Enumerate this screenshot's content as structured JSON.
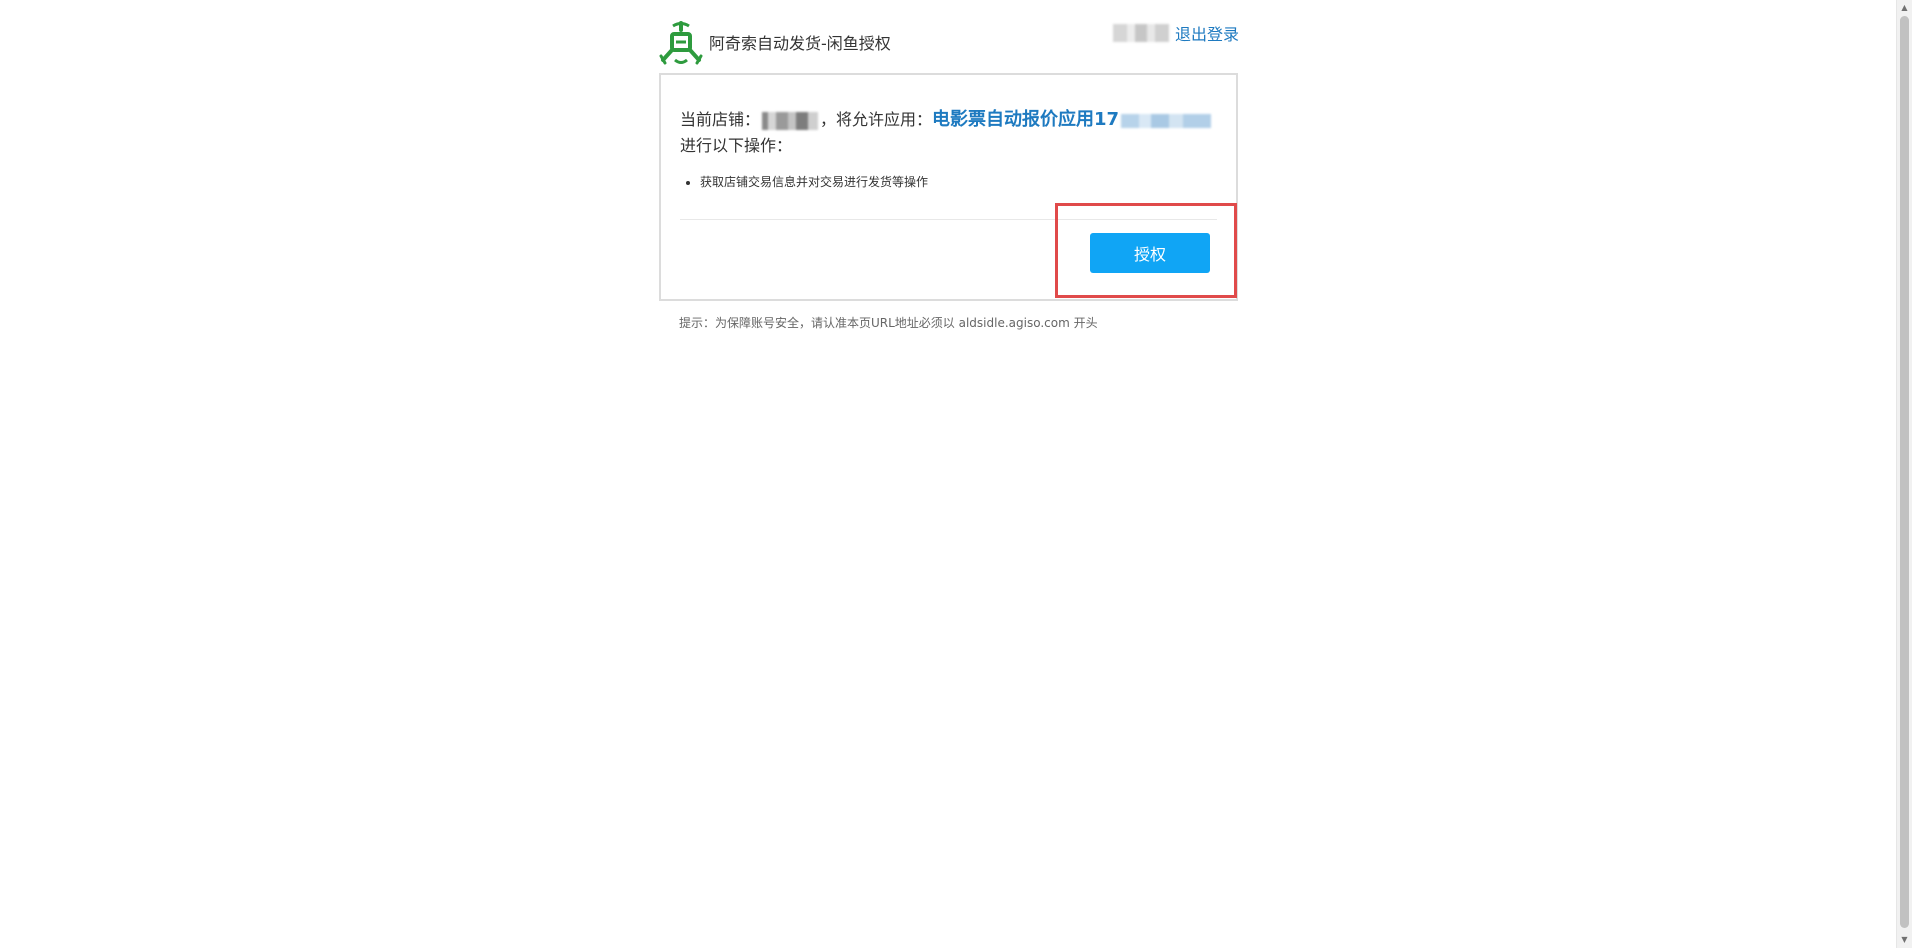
{
  "header": {
    "brand_title": "阿奇索自动发货-闲鱼授权",
    "logout_label": "退出登录"
  },
  "card": {
    "store_prefix": "当前店铺：",
    "allow_text": "，将允许应用：",
    "app_name": "电影票自动报价应用17",
    "operations_prefix": "进行以下操作：",
    "permissions": [
      "获取店铺交易信息并对交易进行发货等操作"
    ],
    "authorize_label": "授权"
  },
  "footer": {
    "hint": "提示：为保障账号安全，请认准本页URL地址必须以 aldsidle.agiso.com 开头"
  },
  "colors": {
    "link_blue": "#1e7ac0",
    "button_blue": "#10a5f5",
    "highlight_red": "#e04a4a",
    "logo_green": "#2e9b3e"
  },
  "icons": {
    "logo": "agiso-logo-icon",
    "scroll_up": "scroll-up-arrow-icon",
    "scroll_down": "scroll-down-arrow-icon"
  }
}
